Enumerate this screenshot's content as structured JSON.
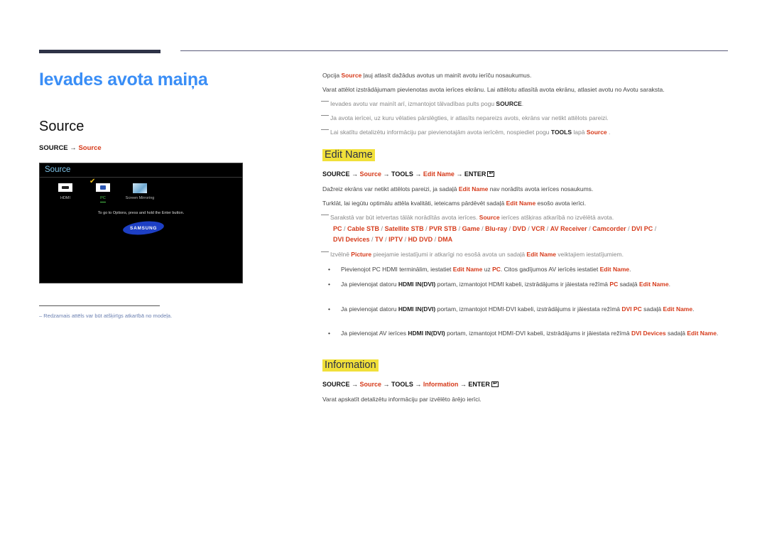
{
  "page": {
    "title": "Ievades avota maiņa",
    "section": "Source",
    "path_left": {
      "a": "SOURCE → ",
      "b": "Source"
    },
    "footnote": "Redzamais attēls var būt atšķirīgs atkarībā no modeļa."
  },
  "tv_screen": {
    "title": "Source",
    "items": [
      {
        "label": "HDMI",
        "icon": "hdmi-icon",
        "selected": false
      },
      {
        "label": "PC",
        "icon": "pc-vga-icon",
        "selected": true
      },
      {
        "label": "Screen Mirroring",
        "icon": "screen-mirroring-icon",
        "selected": false
      }
    ],
    "hint": "To go to Options, press and hold the Enter button.",
    "logo": "SAMSUNG"
  },
  "intro": {
    "p1": {
      "a": "Opcija ",
      "b": "Source",
      "c": " ļauj atlasīt dažādus avotus un mainīt avotu ierīču nosaukumus."
    },
    "p2": "Varat attēlot izstrādājumam pievienotas avota ierīces ekrānu. Lai attēlotu atlasītā avota ekrānu, atlasiet avotu no Avotu saraksta.",
    "n1": {
      "a": "Ievades avotu var mainīt arī, izmantojot tālvadības pults pogu ",
      "b": "SOURCE",
      "c": "."
    },
    "n2": "Ja avota ierīcei, uz kuru vēlaties pārslēgties, ir atlasīts nepareizs avots, ekrāns var netikt attēlots pareizi.",
    "n3": {
      "a": "Lai skatītu detalizētu informāciju par pievienotajām avota ierīcēm, nospiediet pogu ",
      "b": "TOOLS",
      "c": " lapā ",
      "d": "Source",
      "e": " ."
    }
  },
  "edit_name": {
    "heading": "Edit Name",
    "path": {
      "p1": "SOURCE → ",
      "p2": "Source",
      "p3": " → TOOLS → ",
      "p4": "Edit Name",
      "p5": " → ENTER"
    },
    "p1": {
      "a": "Dažreiz ekrāns var netikt attēlots pareizi, ja sadaļā ",
      "b": "Edit Name",
      "c": " nav norādīts avota ierīces nosaukums."
    },
    "p2": {
      "a": "Turklāt, lai iegūtu optimālu attēla kvalitāti, ieteicams pārdēvēt sadaļā ",
      "b": "Edit Name",
      "c": " esošo avota ierīci."
    },
    "n1": {
      "a": "Sarakstā var būt ietvertas tālāk norādītās avota ierīces. ",
      "b": "Source",
      "c": " ierīces atšķiras atkarībā no izvēlētā avota."
    },
    "devices_line1": [
      "PC",
      "Cable STB",
      "Satellite STB",
      "PVR STB",
      "Game",
      "Blu-ray",
      "DVD",
      "VCR",
      "AV Receiver",
      "Camcorder",
      "DVI PC"
    ],
    "devices_line2": [
      "DVI Devices",
      "TV",
      "IPTV",
      "HD DVD",
      "DMA"
    ],
    "n2": {
      "a": "Izvēlnē ",
      "b": "Picture",
      "c": " pieejamie iestatījumi ir atkarīgi no esošā avota un sadaļā ",
      "d": "Edit Name",
      "e": " veiktajiem iestatījumiem."
    },
    "bullets": [
      {
        "a": "Pievienojot PC HDMI terminālim, iestatiet ",
        "b": "Edit Name",
        "c": " uz ",
        "d": "PC",
        "e": ". Citos gadījumos AV ierīcēs iestatiet ",
        "f": "Edit Name",
        "g": "."
      },
      {
        "a": "Ja pievienojat datoru ",
        "b": "HDMI IN(DVI)",
        "c": " portam, izmantojot HDMI kabeli, izstrādājums ir jāiestata režīmā ",
        "d": "PC",
        "e": " sadaļā ",
        "f": "Edit Name",
        "g": "."
      },
      {
        "a": "Ja pievienojat datoru ",
        "b": "HDMI IN(DVI)",
        "c": " portam, izmantojot HDMI-DVI kabeli, izstrādājums ir jāiestata režīmā ",
        "d": "DVI PC",
        "e": " sadaļā ",
        "f": "Edit Name",
        "g": "."
      },
      {
        "a": "Ja pievienojat AV ierīces ",
        "b": "HDMI IN(DVI)",
        "c": " portam, izmantojot HDMI-DVI kabeli, izstrādājums ir jāiestata režīmā ",
        "d": "DVI Devices",
        "e": " sadaļā ",
        "f": "Edit Name",
        "g": "."
      }
    ]
  },
  "information": {
    "heading": "Information",
    "path": {
      "p1": "SOURCE → ",
      "p2": "Source",
      "p3": " → TOOLS → ",
      "p4": "Information",
      "p5": " → ENTER"
    },
    "p1": "Varat apskatīt detalizētu informāciju par izvēlēto ārējo ierīci."
  },
  "colors": {
    "title_blue": "#3a8ef6",
    "accent_red": "#d63b1b",
    "highlight_yellow": "#f1e03a"
  }
}
